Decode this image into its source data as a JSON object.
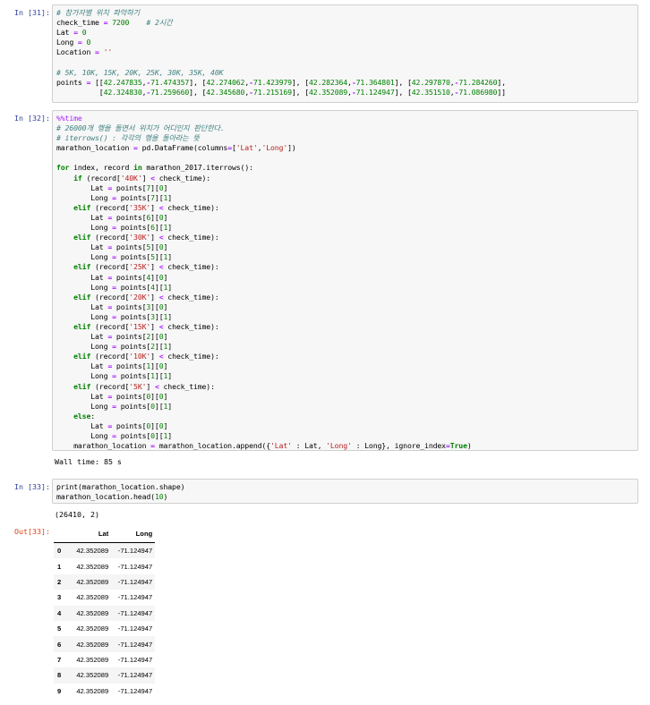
{
  "cells": [
    {
      "prompt": "In [31]:",
      "lines": [
        "# 참가자별 위치 파악하기",
        "check_time = 7200    # 2시간",
        "Lat = 0",
        "Long = 0",
        "Location = ''",
        "",
        "# 5K, 10K, 15K, 20K, 25K, 30K, 35K, 40K",
        "points = [[42.247835,-71.474357], [42.274062,-71.423979], [42.282364,-71.364801], [42.297870,-71.284260],",
        "          [42.324830,-71.259660], [42.345680,-71.215169], [42.352089,-71.124947], [42.351510,-71.086980]]"
      ]
    },
    {
      "prompt": "In [32]:",
      "lines": [
        "%%time",
        "# 26000개 행을 돌면서 위치가 어디인지 판단한다.",
        "# iterrows() : 각각의 행을 돌아라는 뜻",
        "marathon_location = pd.DataFrame(columns=['Lat','Long'])",
        "",
        "for index, record in marathon_2017.iterrows():",
        "    if (record['40K'] < check_time):",
        "        Lat = points[7][0]",
        "        Long = points[7][1]",
        "    elif (record['35K'] < check_time):",
        "        Lat = points[6][0]",
        "        Long = points[6][1]",
        "    elif (record['30K'] < check_time):",
        "        Lat = points[5][0]",
        "        Long = points[5][1]",
        "    elif (record['25K'] < check_time):",
        "        Lat = points[4][0]",
        "        Long = points[4][1]",
        "    elif (record['20K'] < check_time):",
        "        Lat = points[3][0]",
        "        Long = points[3][1]",
        "    elif (record['15K'] < check_time):",
        "        Lat = points[2][0]",
        "        Long = points[2][1]",
        "    elif (record['10K'] < check_time):",
        "        Lat = points[1][0]",
        "        Long = points[1][1]",
        "    elif (record['5K'] < check_time):",
        "        Lat = points[0][0]",
        "        Long = points[0][1]",
        "    else:",
        "        Lat = points[0][0]",
        "        Long = points[0][1]",
        "    marathon_location = marathon_location.append({'Lat' : Lat, 'Long' : Long}, ignore_index=True)"
      ],
      "stdout": "Wall time: 85 s"
    },
    {
      "prompt": "In [33]:",
      "lines": [
        "print(marathon_location.shape)",
        "marathon_location.head(10)"
      ],
      "stdout": "(26410, 2)"
    }
  ],
  "output_prompt": "Out[33]:",
  "dataframe": {
    "columns": [
      "",
      "Lat",
      "Long"
    ],
    "rows": [
      [
        "0",
        "42.352089",
        "-71.124947"
      ],
      [
        "1",
        "42.352089",
        "-71.124947"
      ],
      [
        "2",
        "42.352089",
        "-71.124947"
      ],
      [
        "3",
        "42.352089",
        "-71.124947"
      ],
      [
        "4",
        "42.352089",
        "-71.124947"
      ],
      [
        "5",
        "42.352089",
        "-71.124947"
      ],
      [
        "6",
        "42.352089",
        "-71.124947"
      ],
      [
        "7",
        "42.352089",
        "-71.124947"
      ],
      [
        "8",
        "42.352089",
        "-71.124947"
      ],
      [
        "9",
        "42.352089",
        "-71.124947"
      ]
    ]
  }
}
